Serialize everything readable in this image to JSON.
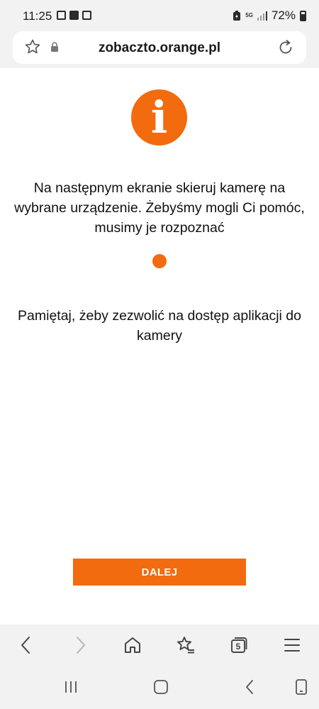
{
  "status_bar": {
    "time": "11:25",
    "network": "5G",
    "battery_percent": "72%",
    "icons": [
      "gallery-icon",
      "app-notification-icon",
      "device-notification-icon",
      "battery-saver-icon",
      "signal-icon",
      "battery-icon"
    ]
  },
  "browser": {
    "url": "zobaczto.orange.pl",
    "tab_count": "5",
    "icons": [
      "bookmark-star-icon",
      "lock-icon",
      "reload-icon"
    ]
  },
  "content": {
    "message_primary": "Na następnym ekranie skieruj kamerę na wybrane urządzenie. Żebyśmy mogli Ci pomóc, musimy je rozpoznać",
    "message_secondary": "Pamiętaj, żeby zezwolić na dostęp aplikacji do kamery",
    "next_button": "DALEJ"
  },
  "colors": {
    "accent": "#f26b0f",
    "chrome_background": "#f2f2f2",
    "text": "#111111"
  }
}
